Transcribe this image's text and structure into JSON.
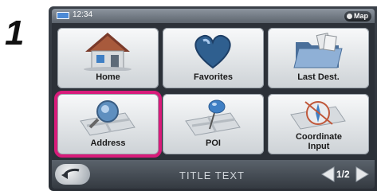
{
  "step_number": "1",
  "status": {
    "time": "12:34",
    "map_label": "Map"
  },
  "tiles": [
    {
      "label": "Home",
      "icon": "house-icon"
    },
    {
      "label": "Favorites",
      "icon": "heart-icon"
    },
    {
      "label": "Last Dest.",
      "icon": "folder-icon"
    },
    {
      "label": "Address",
      "icon": "magnifier-map-icon"
    },
    {
      "label": "POI",
      "icon": "pushpin-icon"
    },
    {
      "label": "Coordinate Input",
      "icon": "compass-icon"
    }
  ],
  "bottom": {
    "title": "TITLE TEXT",
    "page": "1/2"
  },
  "colors": {
    "highlight": "#d81b7a",
    "tile_top": "#f8f9fa",
    "tile_bottom": "#cdd2d6",
    "bezel": "#2c3138"
  }
}
